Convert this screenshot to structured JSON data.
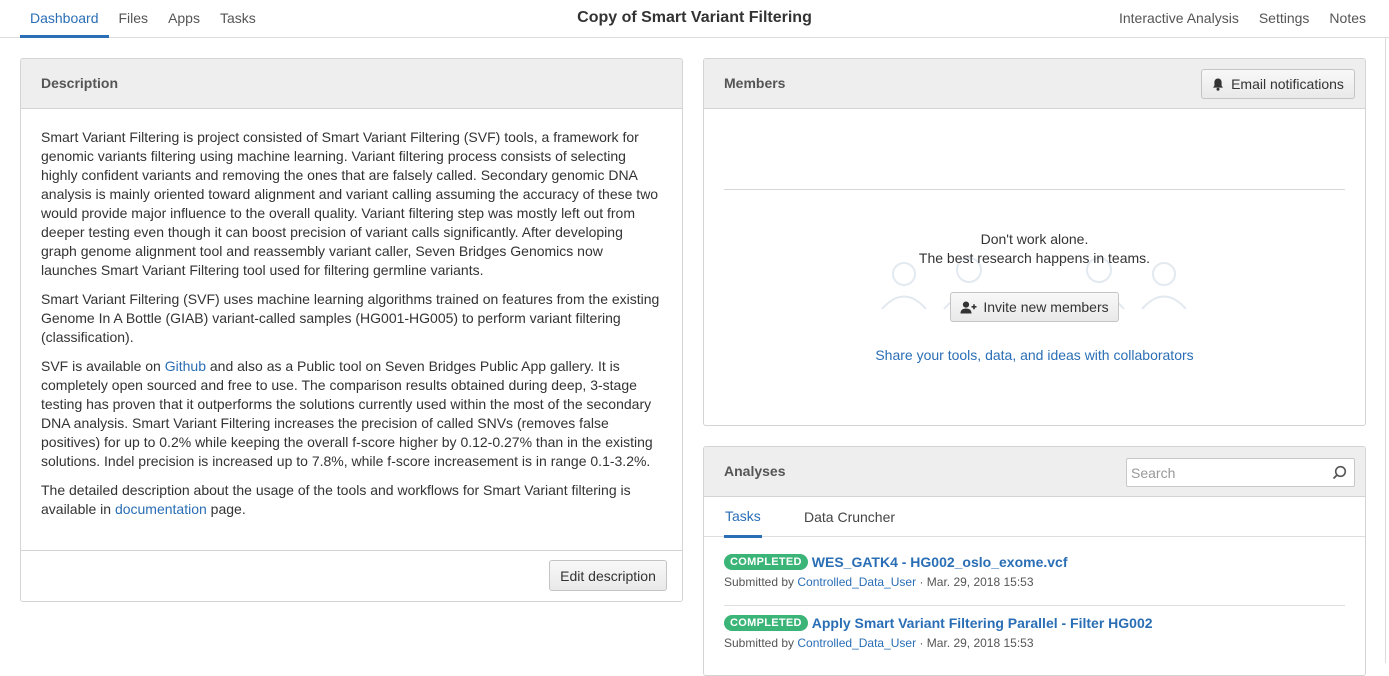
{
  "nav": {
    "tabs": [
      "Dashboard",
      "Files",
      "Apps",
      "Tasks"
    ],
    "title": "Copy of Smart Variant Filtering",
    "right_tabs": [
      "Interactive Analysis",
      "Settings",
      "Notes"
    ]
  },
  "description": {
    "heading": "Description",
    "p1": "Smart Variant Filtering is project consisted of Smart Variant Filtering (SVF) tools, a framework for genomic variants filtering using machine learning. Variant filtering process consists of selecting highly confident variants and removing the ones that are falsely called. Secondary genomic DNA analysis is mainly oriented toward alignment and variant calling assuming the accuracy of these two would provide major influence to the overall quality. Variant filtering step was mostly left out from deeper testing even though it can boost precision of variant calls significantly. After developing graph genome alignment tool and reassembly variant caller, Seven Bridges Genomics now launches Smart Variant Filtering tool used for filtering germline variants.",
    "p2": "Smart Variant Filtering (SVF) uses machine learning algorithms trained on features from the existing Genome In A Bottle (GIAB) variant-called samples (HG001-HG005) to perform variant filtering (classification).",
    "p3_pre": "SVF is available on ",
    "p3_link": "Github",
    "p3_post": " and also as a Public tool on Seven Bridges Public App gallery. It is completely open sourced and free to use. The comparison results obtained during deep, 3-stage testing has proven that it outperforms the solutions currently used within the most of the secondary DNA analysis. Smart Variant Filtering increases the precision of called SNVs (removes false positives) for up to 0.2% while keeping the overall f-score higher by 0.12-0.27% than in the existing solutions. Indel precision is increased up to 7.8%, while f-score increasement is in range 0.1-3.2%.",
    "p4_pre": "The detailed description about the usage of the tools and workflows for Smart Variant filtering is available in ",
    "p4_link": "documentation",
    "p4_post": " page.",
    "edit_label": "Edit description"
  },
  "members": {
    "heading": "Members",
    "email_label": "Email notifications",
    "line1": "Don't work alone.",
    "line2": "The best research happens in teams.",
    "invite_label": "Invite new members",
    "share_text": "Share your tools, data, and ideas with collaborators"
  },
  "analyses": {
    "heading": "Analyses",
    "search_placeholder": "Search",
    "tabs": [
      "Tasks",
      "Data Cruncher"
    ],
    "tasks": [
      {
        "status": "COMPLETED",
        "name": "WES_GATK4 - HG002_oslo_exome.vcf",
        "submitted_by": "Submitted by ",
        "user": "Controlled_Data_User",
        "date": " · Mar. 29, 2018 15:53"
      },
      {
        "status": "COMPLETED",
        "name": "Apply Smart Variant Filtering Parallel - Filter HG002",
        "submitted_by": "Submitted by ",
        "user": "Controlled_Data_User",
        "date": " · Mar. 29, 2018 15:53"
      }
    ]
  },
  "colors": {
    "accent": "#2a6eb5",
    "completed": "#3bb478"
  }
}
